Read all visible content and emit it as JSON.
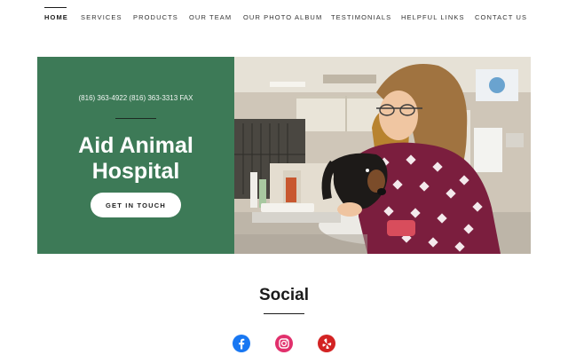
{
  "nav": {
    "items": [
      {
        "label": "HOME",
        "active": true
      },
      {
        "label": "SERVICES"
      },
      {
        "label": "PRODUCTS"
      },
      {
        "label": "OUR TEAM"
      },
      {
        "label": "OUR PHOTO ALBUM"
      },
      {
        "label": "TESTIMONIALS"
      },
      {
        "label": "HELPFUL LINKS"
      },
      {
        "label": "CONTACT US"
      }
    ]
  },
  "hero": {
    "phone": "(816) 363-4922 (816) 363-3313 FAX",
    "title": "Aid Animal Hospital",
    "cta_label": "GET IN TOUCH",
    "panel_color": "#3d7a57"
  },
  "social": {
    "title": "Social",
    "icons": [
      {
        "name": "facebook-icon",
        "color": "#1877f2"
      },
      {
        "name": "instagram-icon",
        "color": "#e1306c"
      },
      {
        "name": "yelp-icon",
        "color": "#d32323"
      }
    ]
  }
}
